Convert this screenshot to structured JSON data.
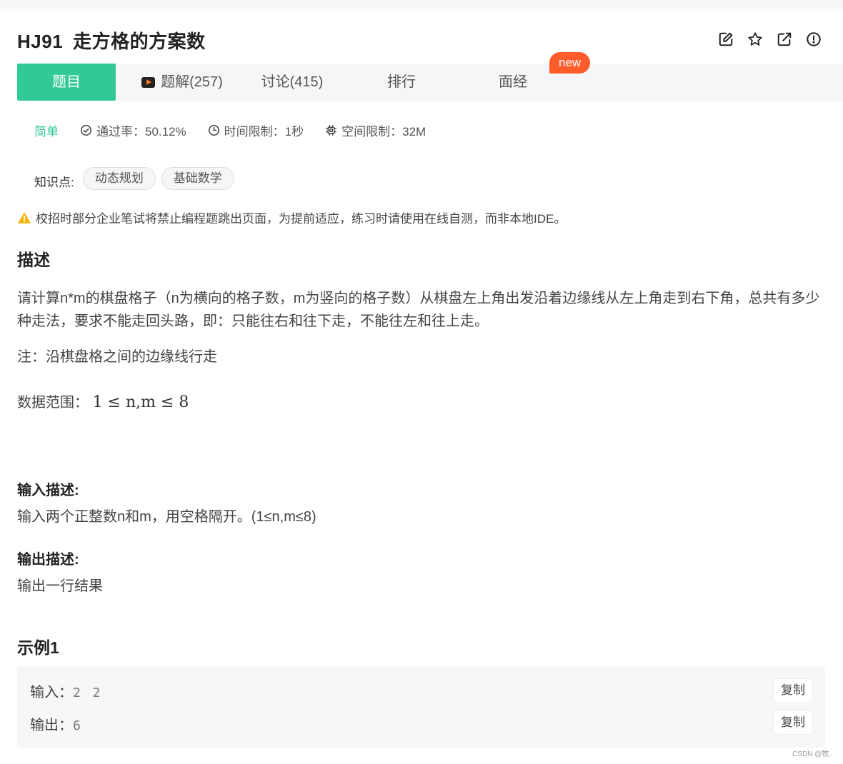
{
  "problem": {
    "code": "HJ91",
    "title": "走方格的方案数"
  },
  "tabs": [
    {
      "label": "题目"
    },
    {
      "label": "题解(257)"
    },
    {
      "label": "讨论(415)"
    },
    {
      "label": "排行"
    },
    {
      "label": "面经"
    }
  ],
  "new_badge": "new",
  "meta": {
    "difficulty": "简单",
    "pass_rate": "通过率：50.12%",
    "time_limit": "时间限制：1秒",
    "memory_limit": "空间限制：32M"
  },
  "knowledge": {
    "label": "知识点:",
    "tags": [
      "动态规划",
      "基础数学"
    ]
  },
  "warning": "校招时部分企业笔试将禁止编程题跳出页面，为提前适应，练习时请使用在线自测，而非本地IDE。",
  "description": {
    "heading": "描述",
    "paragraph": "请计算n*m的棋盘格子（n为横向的格子数，m为竖向的格子数）从棋盘左上角出发沿着边缘线从左上角走到右下角，总共有多少种走法，要求不能走回头路，即：只能往右和往下走，不能往左和往上走。",
    "note": "注：沿棋盘格之间的边缘线行走",
    "range_label": "数据范围：",
    "range_math": "1 ≤ n,m ≤ 8"
  },
  "input": {
    "heading": "输入描述:",
    "text": "输入两个正整数n和m，用空格隔开。(1≤n,m≤8)"
  },
  "output": {
    "heading": "输出描述:",
    "text": "输出一行结果"
  },
  "example": {
    "heading": "示例1",
    "input_label": "输入：",
    "input_value": "2 2",
    "output_label": "输出：",
    "output_value": "6",
    "copy_label": "复制"
  },
  "watermark": "CSDN @牧..",
  "colors": {
    "accent": "#32c997",
    "badge": "#fe5d2b",
    "warning": "#f5b300"
  }
}
